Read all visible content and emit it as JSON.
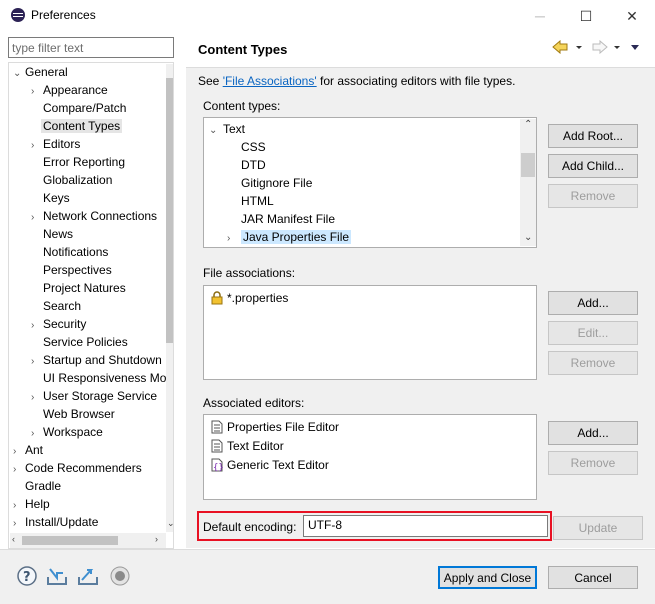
{
  "window": {
    "title": "Preferences",
    "controls": {
      "minimize": "─",
      "maximize": "☐",
      "close": "✕"
    }
  },
  "filter": {
    "placeholder": "type filter text",
    "value": ""
  },
  "tree": [
    {
      "label": "General",
      "arrow": "⌄"
    },
    {
      "label": "Appearance",
      "arrow": "›"
    },
    {
      "label": "Compare/Patch",
      "arrow": ""
    },
    {
      "label": "Content Types",
      "arrow": "",
      "selected": true
    },
    {
      "label": "Editors",
      "arrow": "›"
    },
    {
      "label": "Error Reporting",
      "arrow": ""
    },
    {
      "label": "Globalization",
      "arrow": ""
    },
    {
      "label": "Keys",
      "arrow": ""
    },
    {
      "label": "Network Connections",
      "arrow": "›"
    },
    {
      "label": "News",
      "arrow": ""
    },
    {
      "label": "Notifications",
      "arrow": ""
    },
    {
      "label": "Perspectives",
      "arrow": ""
    },
    {
      "label": "Project Natures",
      "arrow": ""
    },
    {
      "label": "Search",
      "arrow": ""
    },
    {
      "label": "Security",
      "arrow": "›"
    },
    {
      "label": "Service Policies",
      "arrow": ""
    },
    {
      "label": "Startup and Shutdown",
      "arrow": "›"
    },
    {
      "label": "UI Responsiveness Monitoring",
      "arrow": ""
    },
    {
      "label": "User Storage Service",
      "arrow": "›"
    },
    {
      "label": "Web Browser",
      "arrow": ""
    },
    {
      "label": "Workspace",
      "arrow": "›"
    },
    {
      "label": "Ant",
      "arrow": "›"
    },
    {
      "label": "Code Recommenders",
      "arrow": "›"
    },
    {
      "label": "Gradle",
      "arrow": ""
    },
    {
      "label": "Help",
      "arrow": "›"
    },
    {
      "label": "Install/Update",
      "arrow": "›"
    }
  ],
  "page": {
    "title": "Content Types",
    "intro_prefix": "See ",
    "intro_link": "'File Associations'",
    "intro_suffix": " for associating editors with file types.",
    "content_types_label": "Content types:",
    "content_types": [
      {
        "label": "Text",
        "arrow": "⌄"
      },
      {
        "label": "CSS",
        "arrow": ""
      },
      {
        "label": "DTD",
        "arrow": ""
      },
      {
        "label": "Gitignore File",
        "arrow": ""
      },
      {
        "label": "HTML",
        "arrow": ""
      },
      {
        "label": "JAR Manifest File",
        "arrow": ""
      },
      {
        "label": "Java Properties File",
        "arrow": "›",
        "selected": true
      }
    ],
    "add_root": "Add Root...",
    "add_child": "Add Child...",
    "remove": "Remove",
    "file_assoc_label": "File associations:",
    "file_associations": [
      "*.properties"
    ],
    "add": "Add...",
    "edit": "Edit...",
    "assoc_editors_label": "Associated editors:",
    "associated_editors": [
      "Properties File Editor",
      "Text Editor",
      "Generic Text Editor"
    ],
    "encoding_label": "Default encoding:",
    "encoding_value": "UTF-8",
    "update": "Update"
  },
  "bottom": {
    "apply_close": "Apply and Close",
    "cancel": "Cancel"
  },
  "icons": [
    "help-icon",
    "import-icon",
    "export-icon",
    "record-icon"
  ],
  "colors": {
    "highlight": "#e81123",
    "link": "#0a65c2",
    "focus": "#0078d7"
  }
}
